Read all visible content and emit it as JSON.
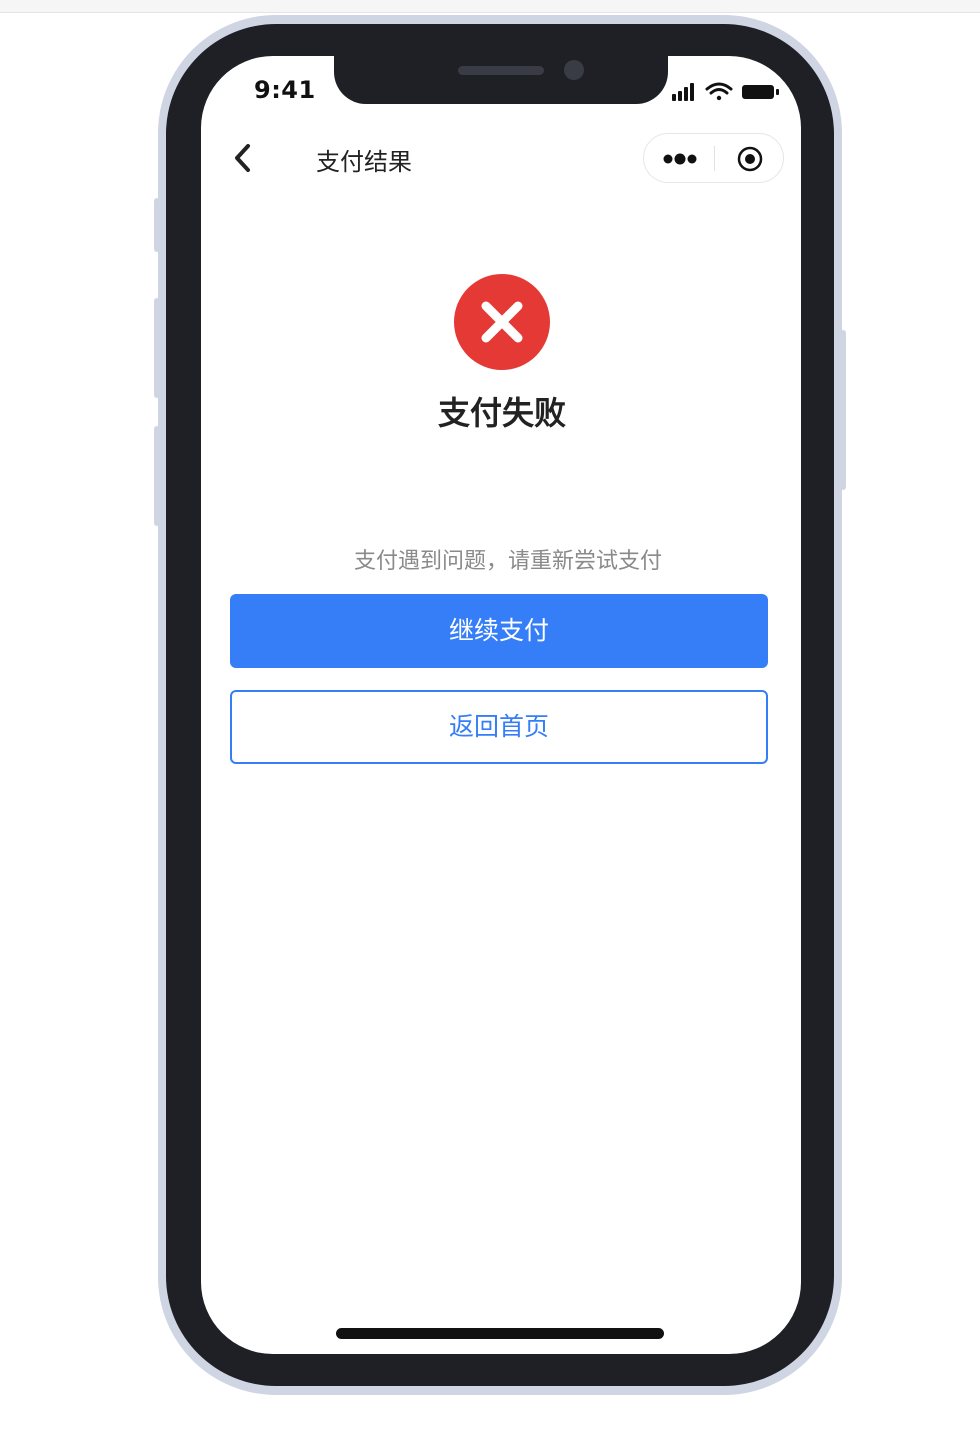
{
  "status_bar": {
    "time": "9:41",
    "icons": [
      "signal-icon",
      "wifi-icon",
      "battery-icon"
    ]
  },
  "nav": {
    "title": "支付结果",
    "back_icon": "chevron-left-icon",
    "capsule_icons": [
      "more-dots-icon",
      "record-target-icon"
    ]
  },
  "result": {
    "icon": "error-x-icon",
    "title": "支付失败",
    "description": "支付遇到问题，请重新尝试支付"
  },
  "actions": {
    "primary_label": "继续支付",
    "secondary_label": "返回首页"
  },
  "colors": {
    "accent": "#357ef7",
    "error": "#e53935",
    "frame": "#1f2026",
    "frame_edge": "#cfd5e2"
  }
}
